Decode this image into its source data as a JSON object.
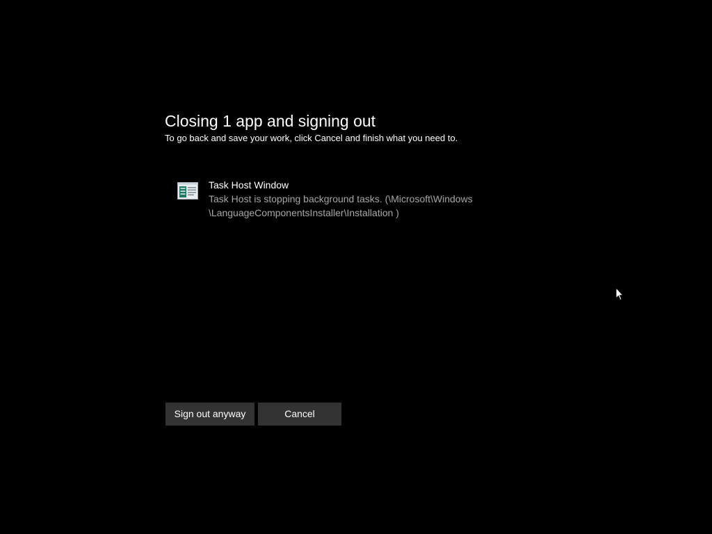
{
  "dialog": {
    "title": "Closing 1 app and signing out",
    "subtitle": "To go back and save your work, click Cancel and finish what you need to."
  },
  "apps": [
    {
      "name": "Task Host Window",
      "description_line1": "Task Host is stopping background tasks. (\\Microsoft\\Windows",
      "description_line2": "\\LanguageComponentsInstaller\\Installation )",
      "icon": "task-host-window-icon"
    }
  ],
  "buttons": {
    "sign_out_label": "Sign out anyway",
    "cancel_label": "Cancel"
  },
  "colors": {
    "background": "#000000",
    "text_primary": "#ffffff",
    "text_secondary": "#a6a6a6",
    "button_background": "#333333"
  },
  "icons": {
    "pointer": "mouse-pointer-icon"
  }
}
